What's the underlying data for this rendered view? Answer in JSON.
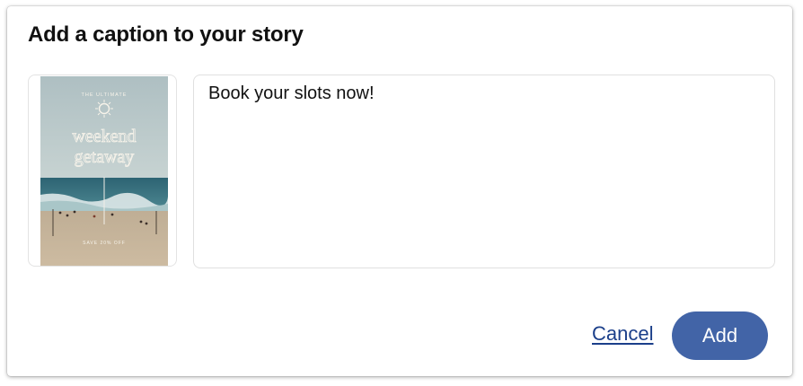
{
  "dialog": {
    "title": "Add a caption to your story"
  },
  "story_preview": {
    "eyebrow": "THE ULTIMATE",
    "headline_line1": "weekend",
    "headline_line2": "getaway",
    "footer": "SAVE 20% OFF",
    "icon": "sun-icon"
  },
  "caption": {
    "value": "Book your slots now!"
  },
  "actions": {
    "cancel_label": "Cancel",
    "add_label": "Add"
  },
  "colors": {
    "primary": "#4264a7",
    "link": "#1b3f8a",
    "sky": "#b9c9cb",
    "sea": "#2f6a7a",
    "sand": "#c8b59a"
  }
}
